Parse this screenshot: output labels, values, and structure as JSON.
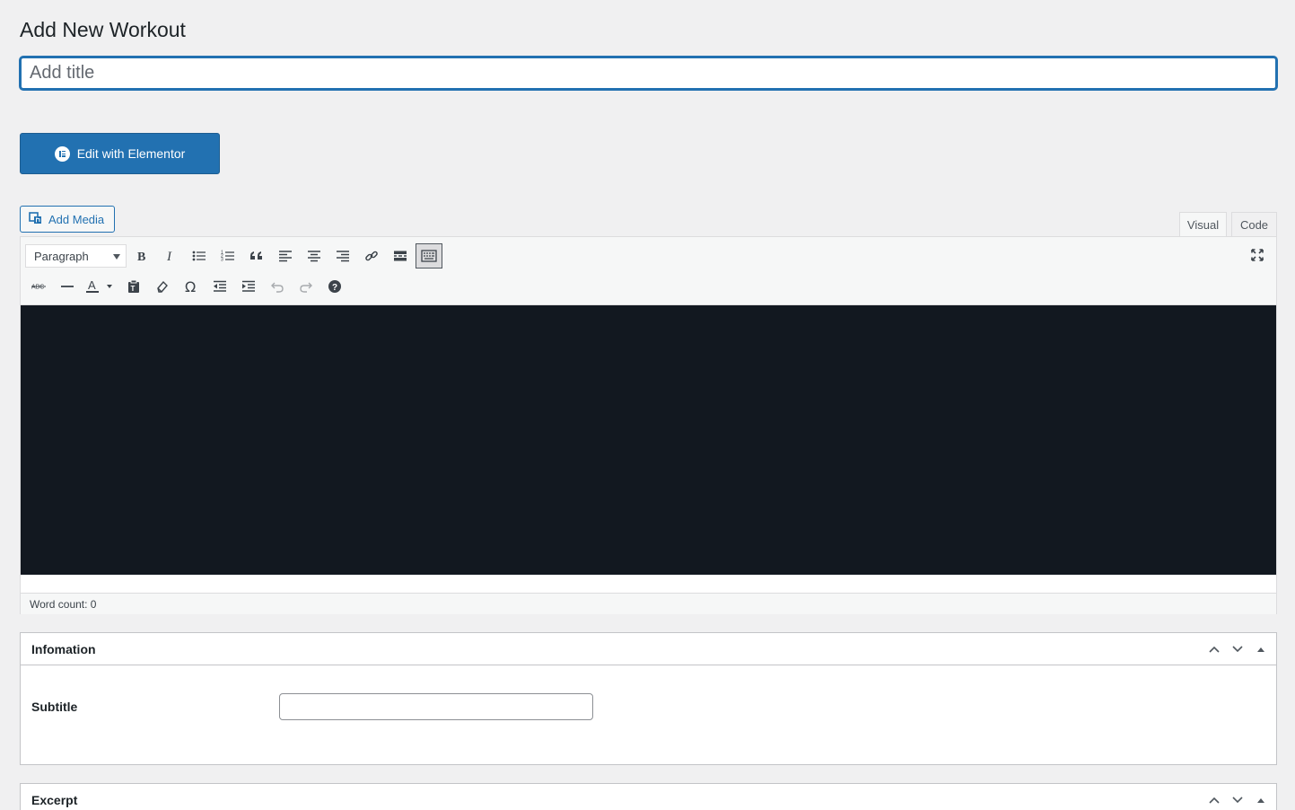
{
  "page": {
    "title": "Add New Workout"
  },
  "title_field": {
    "placeholder": "Add title",
    "value": ""
  },
  "elementor": {
    "label": "Edit with Elementor"
  },
  "media": {
    "label": "Add Media"
  },
  "editor": {
    "tabs": [
      {
        "label": "Visual",
        "active": true
      },
      {
        "label": "Code",
        "active": false
      }
    ],
    "format_select": "Paragraph",
    "toolbar_row1": [
      "bold-icon",
      "italic-icon",
      "bullet-list-icon",
      "numbered-list-icon",
      "blockquote-icon",
      "align-left-icon",
      "align-center-icon",
      "align-right-icon",
      "link-icon",
      "read-more-icon",
      "toolbar-toggle-icon"
    ],
    "toolbar_row2": [
      "strikethrough-icon",
      "horizontal-line-icon",
      "text-color-icon",
      "paste-text-icon",
      "clear-formatting-icon",
      "special-character-icon",
      "outdent-icon",
      "indent-icon",
      "undo-icon",
      "redo-icon",
      "help-icon"
    ],
    "word_count_label": "Word count: 0"
  },
  "metaboxes": [
    {
      "title": "Infomation",
      "field_label": "Subtitle",
      "field_value": ""
    },
    {
      "title": "Excerpt"
    }
  ],
  "colors": {
    "accent": "#2271b1",
    "editor_bg": "#121820",
    "page_bg": "#f0f0f1"
  }
}
